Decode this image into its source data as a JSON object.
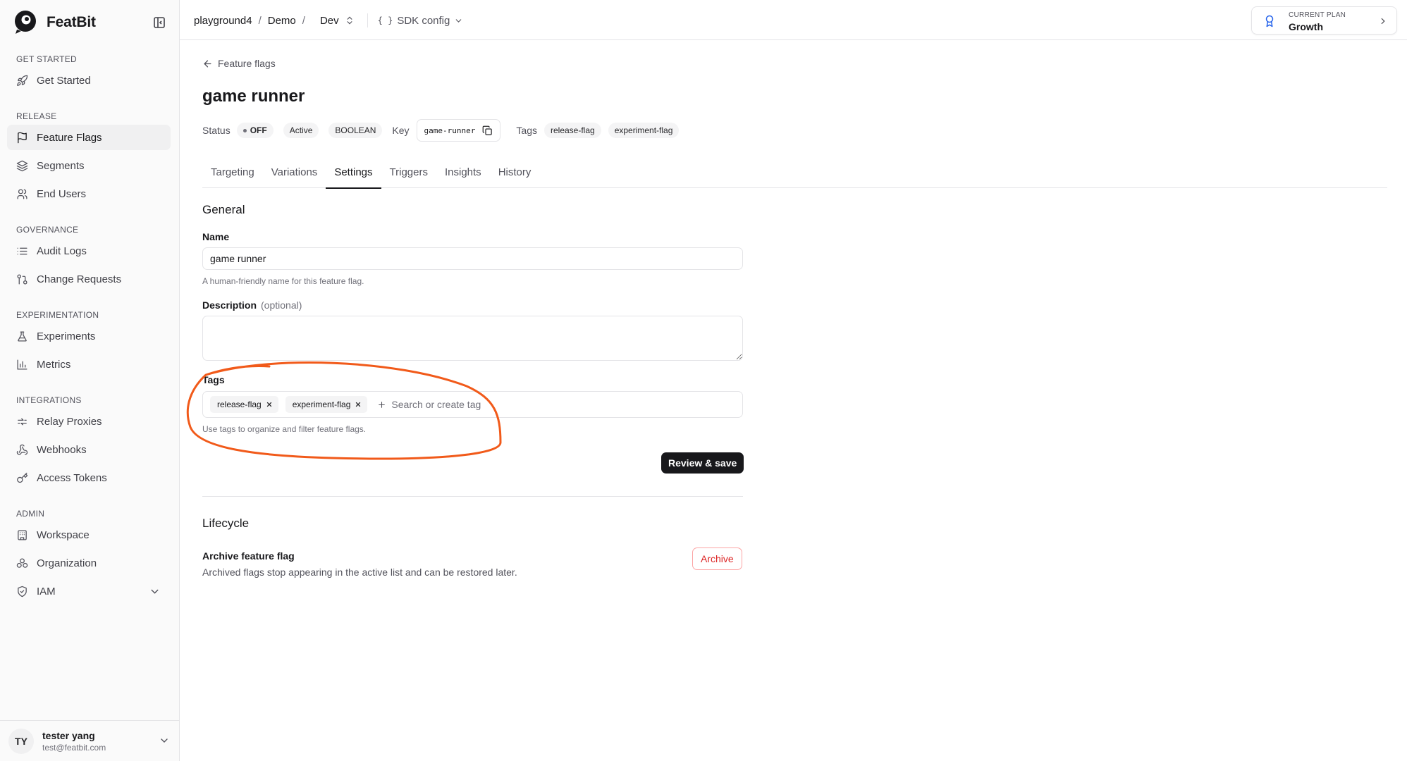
{
  "brand": {
    "name": "FeatBit"
  },
  "nav": {
    "sections": [
      {
        "title": "GET STARTED",
        "items": [
          {
            "label": "Get Started",
            "icon": "rocket-icon"
          }
        ]
      },
      {
        "title": "RELEASE",
        "items": [
          {
            "label": "Feature Flags",
            "icon": "flag-icon",
            "active": true
          },
          {
            "label": "Segments",
            "icon": "layers-icon"
          },
          {
            "label": "End Users",
            "icon": "users-icon"
          }
        ]
      },
      {
        "title": "GOVERNANCE",
        "items": [
          {
            "label": "Audit Logs",
            "icon": "list-icon"
          },
          {
            "label": "Change Requests",
            "icon": "git-pull-request-icon"
          }
        ]
      },
      {
        "title": "EXPERIMENTATION",
        "items": [
          {
            "label": "Experiments",
            "icon": "flask-icon"
          },
          {
            "label": "Metrics",
            "icon": "bar-chart-icon"
          }
        ]
      },
      {
        "title": "INTEGRATIONS",
        "items": [
          {
            "label": "Relay Proxies",
            "icon": "relay-icon"
          },
          {
            "label": "Webhooks",
            "icon": "webhook-icon"
          },
          {
            "label": "Access Tokens",
            "icon": "key-icon"
          }
        ]
      },
      {
        "title": "ADMIN",
        "items": [
          {
            "label": "Workspace",
            "icon": "building-icon"
          },
          {
            "label": "Organization",
            "icon": "org-icon"
          },
          {
            "label": "IAM",
            "icon": "shield-icon",
            "expandable": true
          }
        ]
      }
    ]
  },
  "user": {
    "initials": "TY",
    "name": "tester yang",
    "email": "test@featbit.com"
  },
  "topbar": {
    "breadcrumb": {
      "project": "playground4",
      "env_group": "Demo",
      "env": "Dev"
    },
    "sdk_config": {
      "icon": "{ }",
      "label": "SDK config"
    },
    "plan": {
      "label": "CURRENT PLAN",
      "value": "Growth"
    }
  },
  "flag": {
    "back_label": "Feature flags",
    "title": "game runner",
    "status_label": "Status",
    "status": "OFF",
    "state": "Active",
    "type": "BOOLEAN",
    "key_label": "Key",
    "key": "game-runner",
    "tags_label": "Tags",
    "tags": [
      "release-flag",
      "experiment-flag"
    ]
  },
  "tabs": [
    {
      "label": "Targeting"
    },
    {
      "label": "Variations"
    },
    {
      "label": "Settings",
      "active": true
    },
    {
      "label": "Triggers"
    },
    {
      "label": "Insights"
    },
    {
      "label": "History"
    }
  ],
  "general": {
    "title": "General",
    "name_label": "Name",
    "name_value": "game runner",
    "name_help": "A human-friendly name for this feature flag.",
    "description_label": "Description",
    "description_optional": "(optional)",
    "description_value": "",
    "tags_label": "Tags",
    "tags": [
      "release-flag",
      "experiment-flag"
    ],
    "tags_placeholder": "Search or create tag",
    "tags_help": "Use tags to organize and filter feature flags.",
    "save_label": "Review & save"
  },
  "lifecycle": {
    "title": "Lifecycle",
    "archive_title": "Archive feature flag",
    "archive_desc": "Archived flags stop appearing in the active list and can be restored later.",
    "archive_button": "Archive"
  },
  "colors": {
    "annotation": "#f15a1a",
    "primary": "#18181b",
    "danger": "#dc2626",
    "plan_icon": "#2563eb"
  }
}
